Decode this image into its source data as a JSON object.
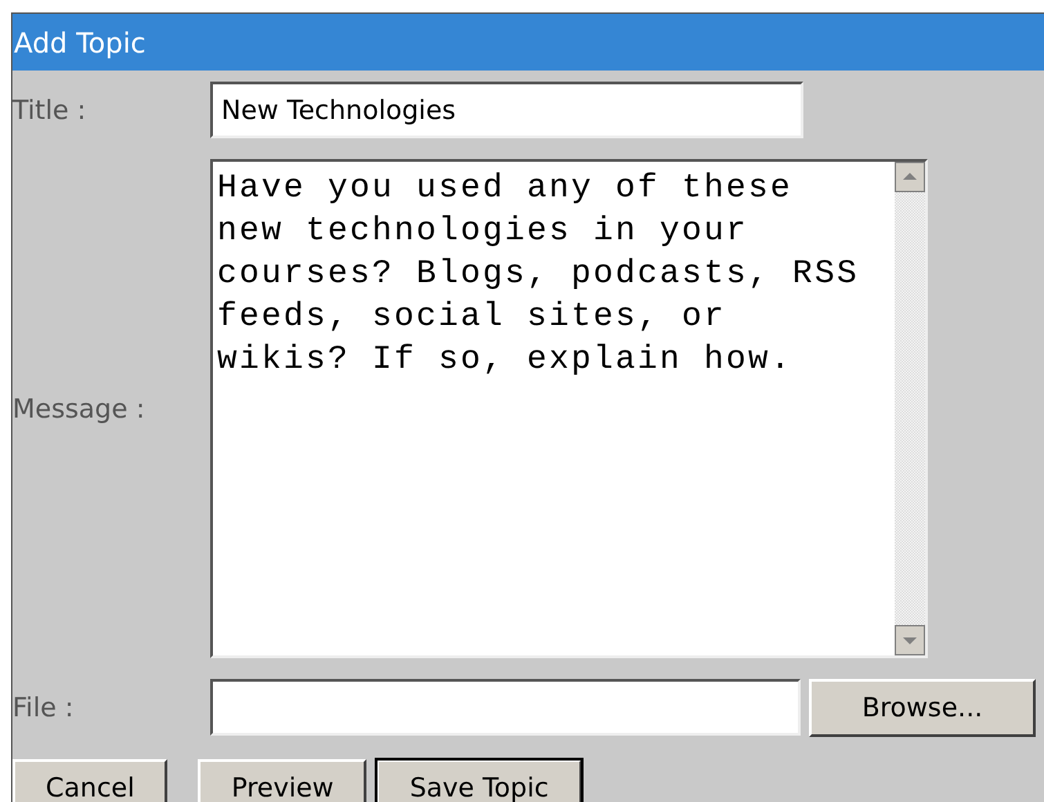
{
  "window": {
    "title": "Add Topic"
  },
  "fields": [
    {
      "kind": "text",
      "label": "Title :",
      "value": "New Technologies"
    },
    {
      "kind": "textarea",
      "label": "Message :",
      "value": "Have you used any of these new technologies in your courses? Blogs, podcasts, RSS feeds, social sites, or wikis? If so, explain how."
    },
    {
      "kind": "file",
      "label": "File :",
      "button": "Browse..."
    }
  ],
  "buttons": [
    {
      "label": "Cancel",
      "focused": false
    },
    {
      "label": "Preview",
      "focused": false
    },
    {
      "label": "Save Topic",
      "focused": true
    }
  ]
}
